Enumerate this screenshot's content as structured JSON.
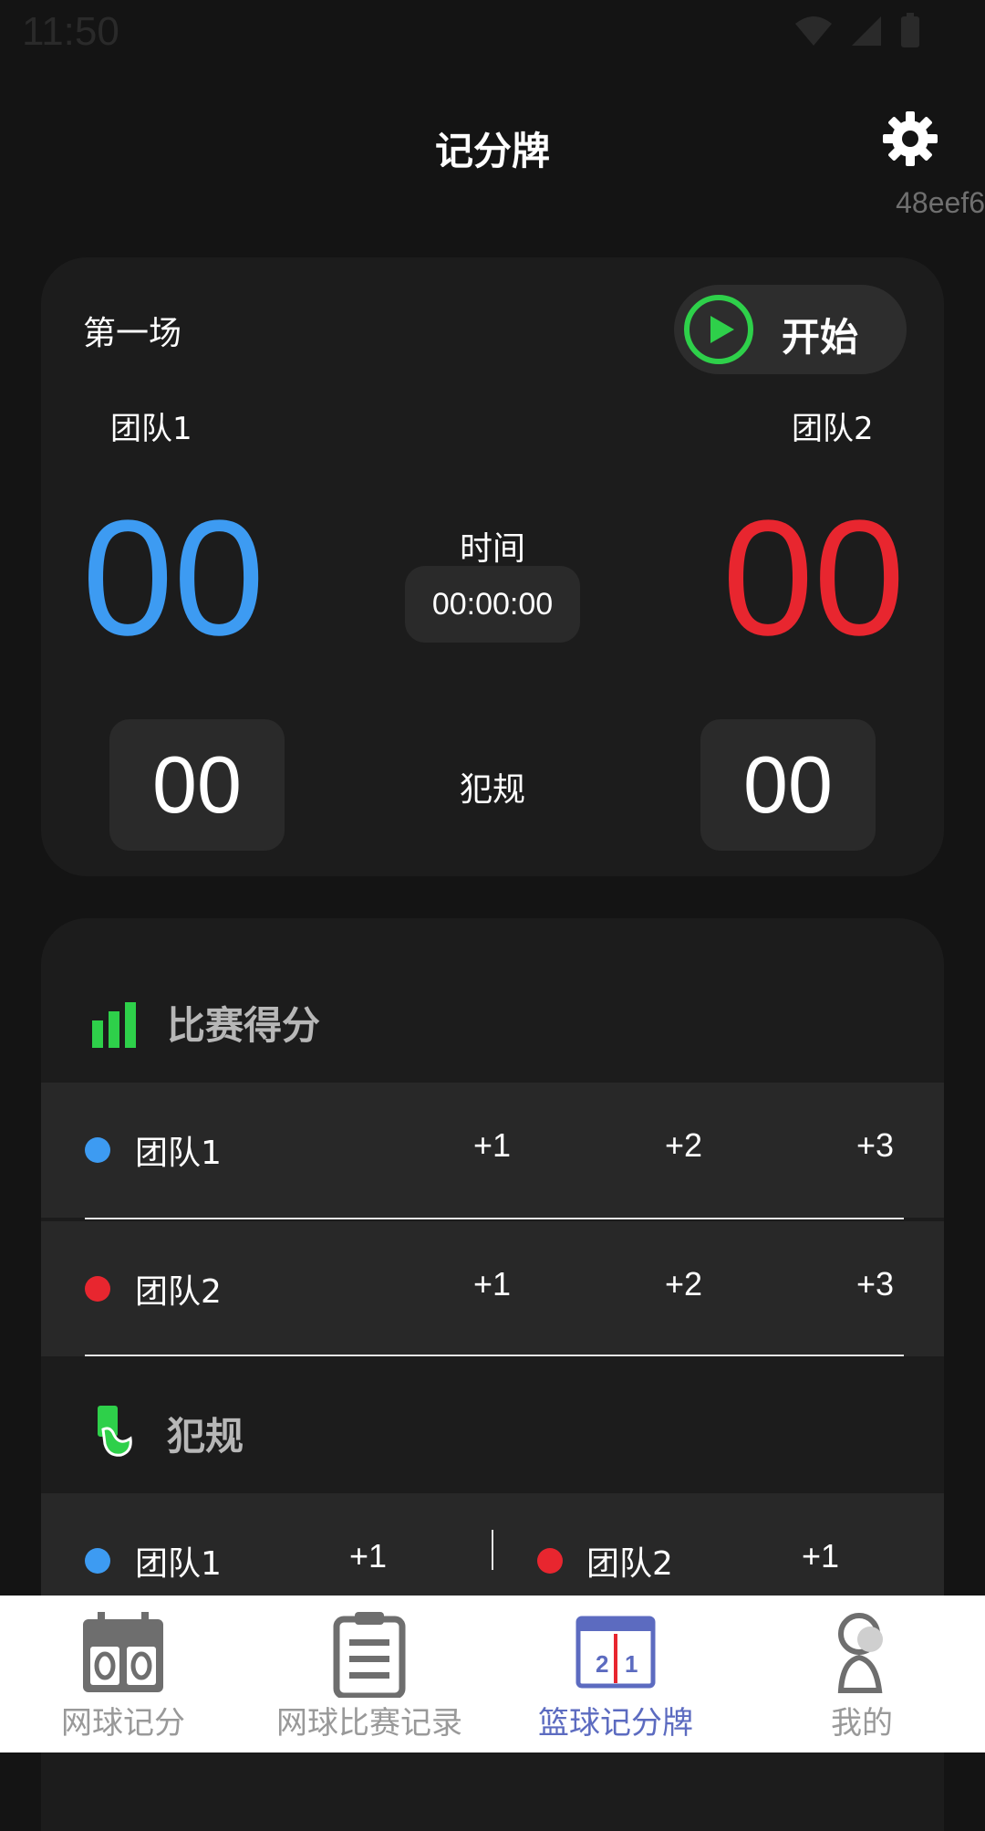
{
  "status": {
    "time": "11:50"
  },
  "header": {
    "title": "记分牌",
    "device_id": "48eef6"
  },
  "scoreboard": {
    "match": "第一场",
    "start_label": "开始",
    "team1": {
      "name": "团队1",
      "score": "00",
      "fouls": "00",
      "color": "#3d9bf2"
    },
    "team2": {
      "name": "团队2",
      "score": "00",
      "fouls": "00",
      "color": "#e8262f"
    },
    "time_label": "时间",
    "time_value": "00:00:00",
    "foul_label": "犯规"
  },
  "points_section": {
    "title": "比赛得分",
    "rows": [
      {
        "team": "团队1",
        "p1": "+1",
        "p2": "+2",
        "p3": "+3"
      },
      {
        "team": "团队2",
        "p1": "+1",
        "p2": "+2",
        "p3": "+3"
      }
    ]
  },
  "fouls_section": {
    "title": "犯规",
    "team1": "团队1",
    "team1_add": "+1",
    "team2": "团队2",
    "team2_add": "+1"
  },
  "tabs": [
    {
      "label": "网球记分",
      "icon": "scoreboard-icon"
    },
    {
      "label": "网球比赛记录",
      "icon": "clipboard-icon"
    },
    {
      "label": "篮球记分牌",
      "icon": "basketball-scoreboard-icon",
      "active": true
    },
    {
      "label": "我的",
      "icon": "user-icon"
    }
  ],
  "colors": {
    "accent_green": "#2ed04a",
    "active_tab": "#5c6bc0"
  }
}
